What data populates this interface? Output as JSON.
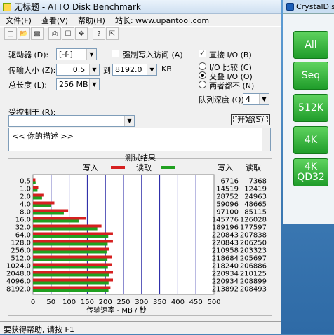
{
  "window": {
    "title": "无标题 - ATTO Disk Benchmark"
  },
  "menu": [
    "文件(F)",
    "查看(V)",
    "帮助(H)",
    "站长: www.upantool.com"
  ],
  "toolbar": [
    "new-icon",
    "open-icon",
    "save-icon",
    "print-icon",
    "print-preview-icon",
    "move-icon",
    "help-icon",
    "context-help-icon"
  ],
  "form": {
    "drive_label": "驱动器 (D):",
    "drive_value": "[-f-]",
    "force_write_label": "强制写入访问 (A)",
    "transfer_label": "传输大小 (Z):",
    "transfer_from": "0.5",
    "transfer_to_label": "到",
    "transfer_to": "8192.0",
    "transfer_unit": "KB",
    "direct_io_label": "直接 I/O (B)",
    "total_label": "总长度 (L):",
    "total_value": "256 MB",
    "io_compare_label": "I/O 比较 (C)",
    "overlap_label": "交叠 I/O (O)",
    "neither_label": "两者都不 (N)",
    "queue_label": "队列深度 (Q):",
    "queue_value": "4",
    "controlled_label": "受控制于 (R):",
    "controlled_value": "",
    "start_button": "开始(S)",
    "description": "<<  你的描述  >>"
  },
  "results": {
    "group_title": "测试结果",
    "write_legend": "写入",
    "read_legend": "读取",
    "write_col": "写入",
    "read_col": "读取"
  },
  "status": "要获得帮助, 请按 F1",
  "cdm": {
    "title": "CrystalDiskMark",
    "buttons": [
      "All",
      "Seq",
      "512K",
      "4K",
      "4K\nQD32"
    ]
  },
  "chart_data": {
    "type": "bar",
    "orientation": "horizontal",
    "title": "测试结果",
    "xlabel": "传输速率 - MB / 秒",
    "xlim": [
      0,
      500
    ],
    "xticks": [
      0,
      50,
      100,
      150,
      200,
      250,
      300,
      350,
      400,
      450,
      500
    ],
    "categories": [
      "0.5",
      "1.0",
      "2.0",
      "4.0",
      "8.0",
      "16.0",
      "32.0",
      "64.0",
      "128.0",
      "256.0",
      "512.0",
      "1024.0",
      "2048.0",
      "4096.0",
      "8192.0"
    ],
    "series": [
      {
        "name": "写入",
        "color": "#d62020",
        "values": [
          6716,
          14519,
          28752,
          59096,
          97100,
          145776,
          189196,
          220843,
          220843,
          210958,
          218684,
          218240,
          220934,
          220934,
          213892
        ]
      },
      {
        "name": "读取",
        "color": "#20a020",
        "values": [
          7368,
          12419,
          24963,
          48665,
          85115,
          126028,
          177597,
          207838,
          206250,
          203323,
          205697,
          206886,
          210125,
          208899,
          208493
        ]
      }
    ]
  }
}
